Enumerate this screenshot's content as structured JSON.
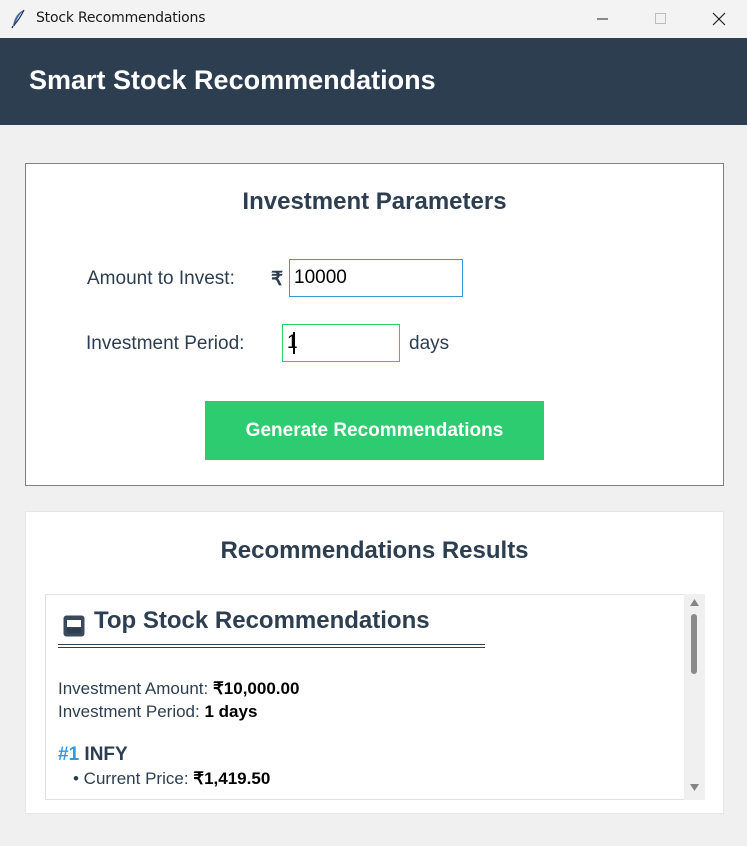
{
  "window": {
    "title": "Stock Recommendations",
    "icon": "feather-icon"
  },
  "header": {
    "title": "Smart Stock Recommendations"
  },
  "params": {
    "title": "Investment Parameters",
    "amount_label": "Amount to Invest:",
    "currency_symbol": "₹",
    "amount_value": "10000",
    "period_label": "Investment Period:",
    "period_value": "1",
    "period_unit": "days",
    "generate_label": "Generate Recommendations"
  },
  "results": {
    "title": "Recommendations Results",
    "heading": "Top Stock Recommendations",
    "heading_icon": "portfolio-icon",
    "amount_label": "Investment Amount:",
    "amount_value": "₹10,000.00",
    "period_label": "Investment Period:",
    "period_value": "1 days",
    "items": [
      {
        "rank": "#1",
        "symbol": "INFY",
        "price_label": "• Current Price:",
        "price_value": "₹1,419.50"
      }
    ]
  },
  "colors": {
    "header_bg": "#2c3e50",
    "accent_green": "#2ecc71",
    "accent_blue": "#3498db",
    "text_dark": "#2c3e50"
  }
}
